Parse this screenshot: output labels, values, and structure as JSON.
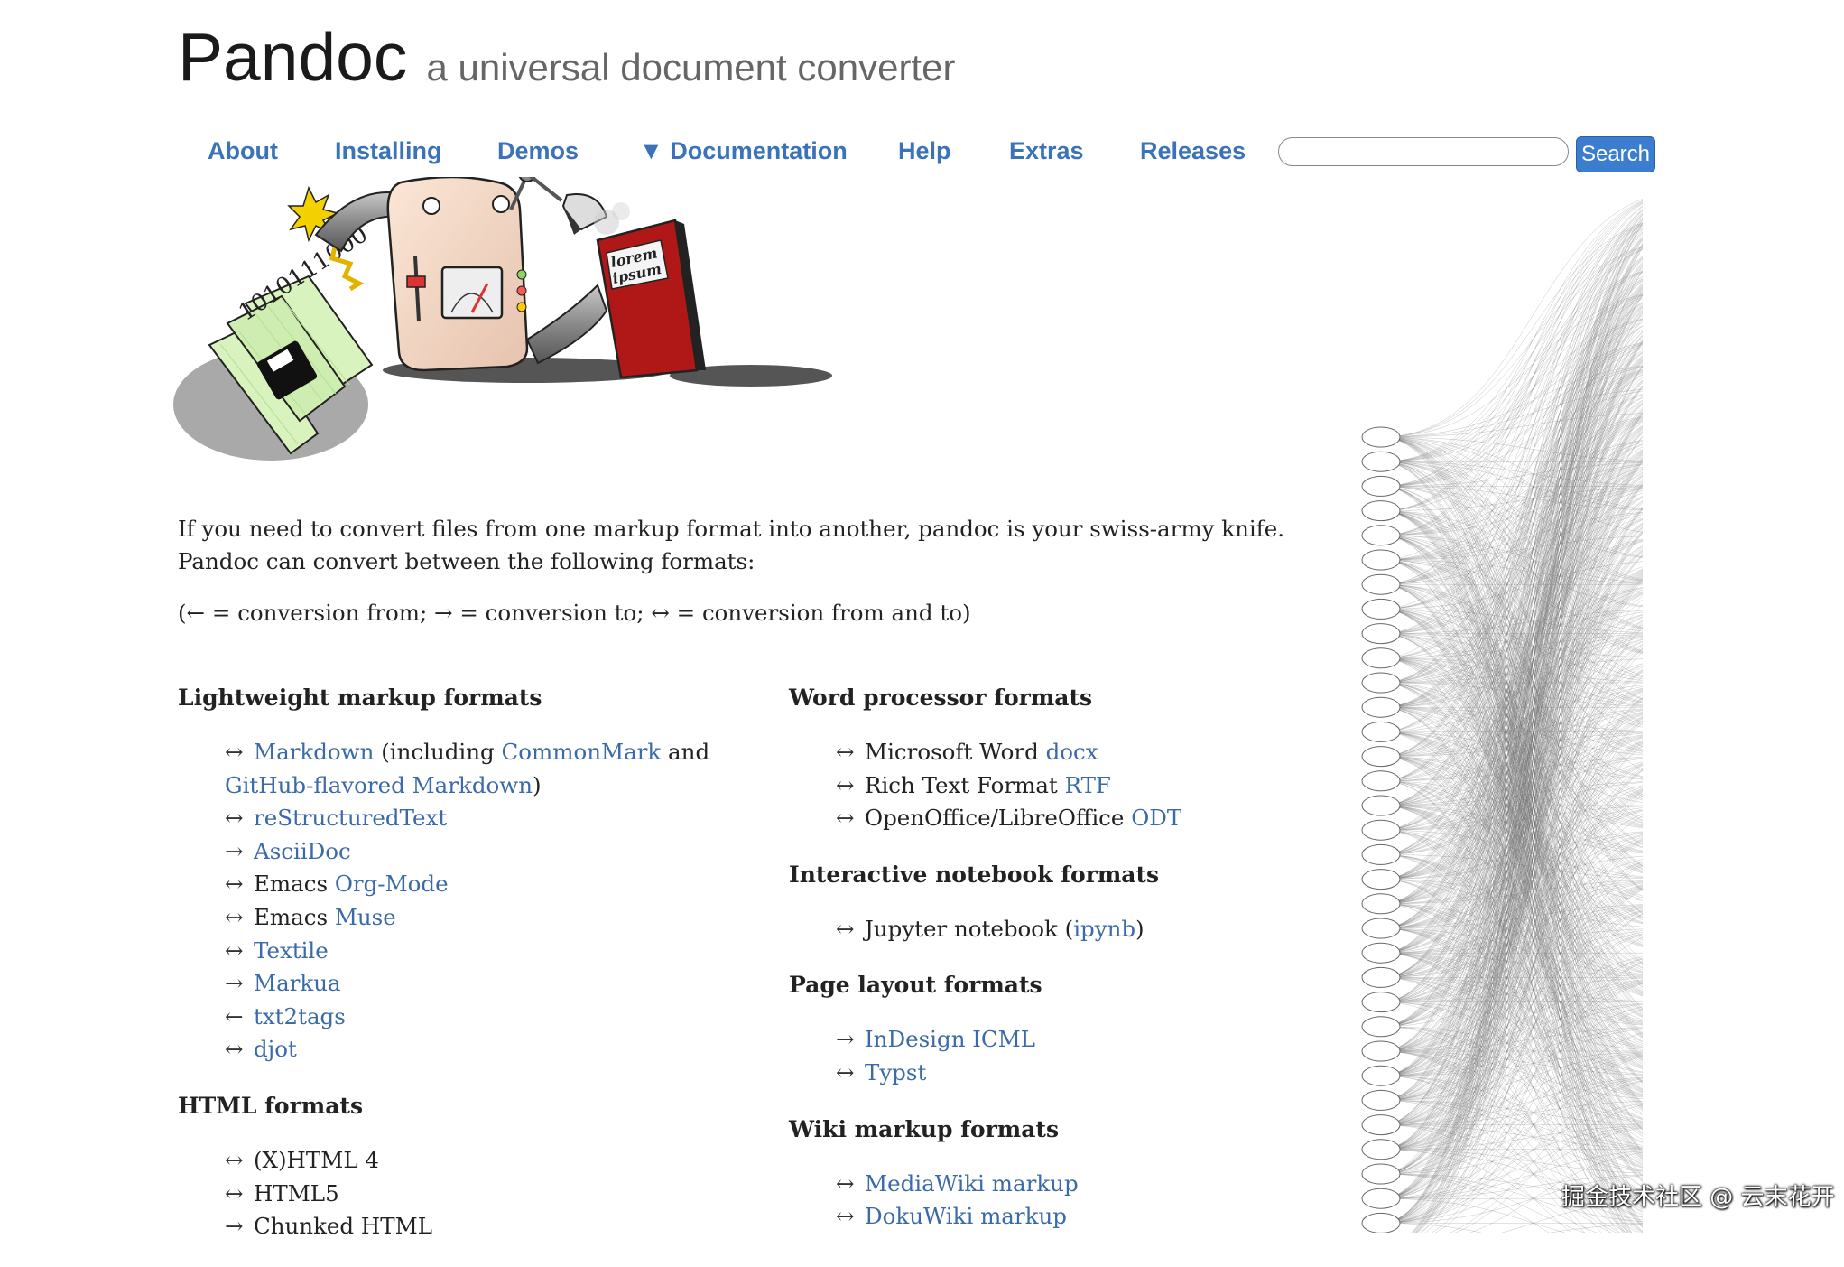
{
  "header": {
    "brand": "Pandoc",
    "tagline": "a universal document converter"
  },
  "nav": {
    "items": [
      "About",
      "Installing",
      "Demos",
      "▼ Documentation",
      "Help",
      "Extras",
      "Releases"
    ]
  },
  "search": {
    "placeholder": "",
    "button_label": "Search"
  },
  "logo": {
    "binary_text": "1010111000",
    "book_text": [
      "lorem",
      "ipsum"
    ]
  },
  "intro": {
    "text": "If you need to convert files from one markup format into another, pandoc is your swiss-army knife. Pandoc can convert between the following formats:",
    "legend": "(← = conversion from; → = conversion to; ↔ = conversion from and to)"
  },
  "left_column": {
    "sections": [
      {
        "title": "Lightweight markup formats",
        "items": [
          {
            "arrow": "↔",
            "parts": [
              {
                "t": "Markdown",
                "link": true
              },
              {
                "t": " (including ",
                "link": false
              },
              {
                "t": "CommonMark",
                "link": true
              },
              {
                "t": " and",
                "link": false
              }
            ]
          },
          {
            "arrow": "",
            "parts": [
              {
                "t": "GitHub-flavored Markdown",
                "link": true
              },
              {
                "t": ")",
                "link": false
              }
            ]
          },
          {
            "arrow": "↔",
            "parts": [
              {
                "t": "reStructuredText",
                "link": true
              }
            ]
          },
          {
            "arrow": "→",
            "parts": [
              {
                "t": "AsciiDoc",
                "link": true
              }
            ]
          },
          {
            "arrow": "↔",
            "parts": [
              {
                "t": "Emacs ",
                "link": false
              },
              {
                "t": "Org-Mode",
                "link": true
              }
            ]
          },
          {
            "arrow": "↔",
            "parts": [
              {
                "t": "Emacs ",
                "link": false
              },
              {
                "t": "Muse",
                "link": true
              }
            ]
          },
          {
            "arrow": "↔",
            "parts": [
              {
                "t": "Textile",
                "link": true
              }
            ]
          },
          {
            "arrow": "→",
            "parts": [
              {
                "t": "Markua",
                "link": true
              }
            ]
          },
          {
            "arrow": "←",
            "parts": [
              {
                "t": "txt2tags",
                "link": true
              }
            ]
          },
          {
            "arrow": "↔",
            "parts": [
              {
                "t": "djot",
                "link": true
              }
            ]
          }
        ]
      },
      {
        "title": "HTML formats",
        "items": [
          {
            "arrow": "↔",
            "parts": [
              {
                "t": "(X)HTML 4",
                "link": false
              }
            ]
          },
          {
            "arrow": "↔",
            "parts": [
              {
                "t": "HTML5",
                "link": false
              }
            ]
          },
          {
            "arrow": "→",
            "parts": [
              {
                "t": "Chunked HTML",
                "link": false
              }
            ]
          }
        ]
      }
    ]
  },
  "right_column": {
    "sections": [
      {
        "title": "Word processor formats",
        "items": [
          {
            "arrow": "↔",
            "parts": [
              {
                "t": "Microsoft Word ",
                "link": false
              },
              {
                "t": "docx",
                "link": true
              }
            ]
          },
          {
            "arrow": "↔",
            "parts": [
              {
                "t": "Rich Text Format ",
                "link": false
              },
              {
                "t": "RTF",
                "link": true
              }
            ]
          },
          {
            "arrow": "↔",
            "parts": [
              {
                "t": "OpenOffice/LibreOffice ",
                "link": false
              },
              {
                "t": "ODT",
                "link": true
              }
            ]
          }
        ]
      },
      {
        "title": "Interactive notebook formats",
        "items": [
          {
            "arrow": "↔",
            "parts": [
              {
                "t": "Jupyter notebook (",
                "link": false
              },
              {
                "t": "ipynb",
                "link": true
              },
              {
                "t": ")",
                "link": false
              }
            ]
          }
        ]
      },
      {
        "title": "Page layout formats",
        "items": [
          {
            "arrow": "→",
            "parts": [
              {
                "t": "InDesign ICML",
                "link": true
              }
            ]
          },
          {
            "arrow": "↔",
            "parts": [
              {
                "t": "Typst",
                "link": true
              }
            ]
          }
        ]
      },
      {
        "title": "Wiki markup formats",
        "items": [
          {
            "arrow": "↔",
            "parts": [
              {
                "t": "MediaWiki markup",
                "link": true
              }
            ]
          },
          {
            "arrow": "↔",
            "parts": [
              {
                "t": "DokuWiki markup",
                "link": true
              }
            ]
          }
        ]
      }
    ]
  },
  "watermark": "掘金技术社区 @ 云末花开",
  "colors": {
    "link": "#3b6aa8",
    "nav": "#3b73b9",
    "search_button": "#3b7ed0"
  }
}
